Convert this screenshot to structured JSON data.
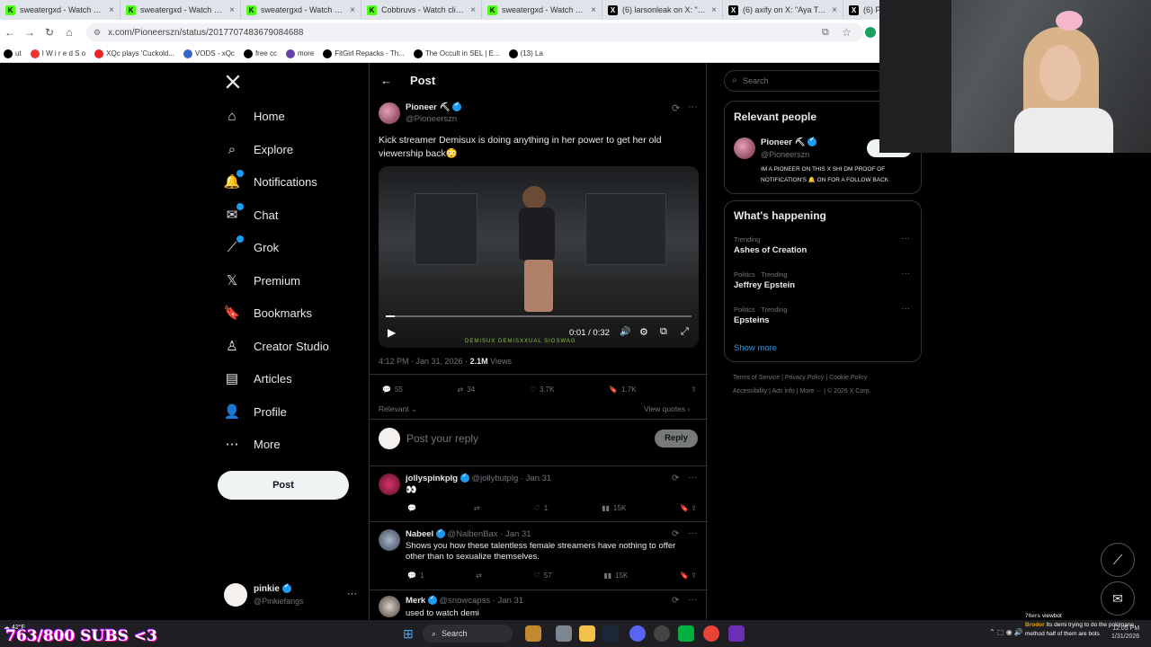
{
  "browser": {
    "tabs": [
      {
        "title": "sweatergxd - Watch clips o",
        "color": "#53fc18"
      },
      {
        "title": "sweatergxd - Watch clips o",
        "color": "#53fc18"
      },
      {
        "title": "sweatergxd - Watch clips o",
        "color": "#53fc18"
      },
      {
        "title": "Cobbruvs - Watch clips on",
        "color": "#53fc18"
      },
      {
        "title": "sweatergxd - Watch clips o",
        "color": "#53fc18"
      },
      {
        "title": "(6) larsonleak on X: \"Joshu",
        "color": "#000000"
      },
      {
        "title": "(6) axify on X: \"Aya Tanjali",
        "color": "#000000"
      },
      {
        "title": "(6) P",
        "color": "#000000"
      }
    ],
    "url": "x.com/Pioneerszn/status/2017707483679084688",
    "bookmarks": [
      "ut",
      "I W i r e d   S o",
      "XQc plays 'Cuckold...",
      "VODS - xQc",
      "free cc",
      "more",
      "FitGirl Repacks - Th...",
      "The Occult in SEL | E...",
      "(13) La"
    ]
  },
  "nav": {
    "items": [
      {
        "label": "Home"
      },
      {
        "label": "Explore"
      },
      {
        "label": "Notifications"
      },
      {
        "label": "Chat"
      },
      {
        "label": "Grok"
      },
      {
        "label": "Premium"
      },
      {
        "label": "Bookmarks"
      },
      {
        "label": "Creator Studio"
      },
      {
        "label": "Articles"
      },
      {
        "label": "Profile"
      },
      {
        "label": "More"
      }
    ],
    "post_label": "Post",
    "account": {
      "name": "pinkie",
      "handle": "@Pinkiefangs"
    }
  },
  "post": {
    "header_title": "Post",
    "author_name": "Pioneer",
    "author_handle": "@Pioneerszn",
    "text": "Kick streamer Demisux is doing anything in her power to get her old viewership back😳",
    "video_time": "0:01 / 0:32",
    "video_watermark": "DEMISUX  DEMISXXUAL  SIOSWAG",
    "video_progress": 0.03,
    "timestamp": "4:12 PM · Jan 31, 2026 ·",
    "views_count": "2.1M",
    "views_label": "Views",
    "replies": "55",
    "reposts": "34",
    "likes": "3.7K",
    "bookmarks": "1.7K",
    "sort_label": "Relevant",
    "view_quotes": "View quotes",
    "reply_placeholder": "Post your reply",
    "reply_button": "Reply"
  },
  "replies": [
    {
      "name": "jollyspinkplg",
      "handle": "@jollybutplg · Jan 31",
      "text": "👀",
      "replies": "",
      "likes": "1",
      "views": "15K"
    },
    {
      "name": "Nabeel",
      "handle": "@NalbenBax · Jan 31",
      "text": "Shows you how these talentless female streamers have nothing to offer other than to sexualize themselves.",
      "replies": "1",
      "likes": "57",
      "views": "15K"
    },
    {
      "name": "Merk",
      "handle": "@snowcapss · Jan 31",
      "text": "used to watch demi"
    }
  ],
  "right": {
    "search_placeholder": "Search",
    "relevant_title": "Relevant people",
    "person_name": "Pioneer",
    "person_handle": "@Pioneerszn",
    "person_bio": "IM A PIONEER ON THIS X SHI DM PROOF OF NOTIFICATION'S 🔔 ON FOR A FOLLOW BACK",
    "happening_title": "What's happening",
    "trends": [
      {
        "meta": "Trending",
        "name": "Ashes of Creation"
      },
      {
        "meta": "Politics · Trending",
        "name": "Jeffrey Epstein"
      },
      {
        "meta": "Politics · Trending",
        "name": "Epsteins"
      }
    ],
    "show_more": "Show more",
    "footer_line1": [
      "Terms of Service",
      "Privacy Policy",
      "Cookie Policy"
    ],
    "footer_line2": [
      "Accessibility",
      "Ads info",
      "More ···",
      "© 2026 X Corp."
    ]
  },
  "overlay": {
    "subs": "763/800 SUBS <3",
    "temp": "42°F",
    "chat_user1": "76ers",
    "chat_msg1": "viewbot",
    "chat_user2": "Brodor",
    "chat_msg2": "Its demi trying to do the pokimane method half of them are bots"
  },
  "taskbar": {
    "search": "Search",
    "time": "12:05 PM",
    "date": "1/31/2026"
  }
}
